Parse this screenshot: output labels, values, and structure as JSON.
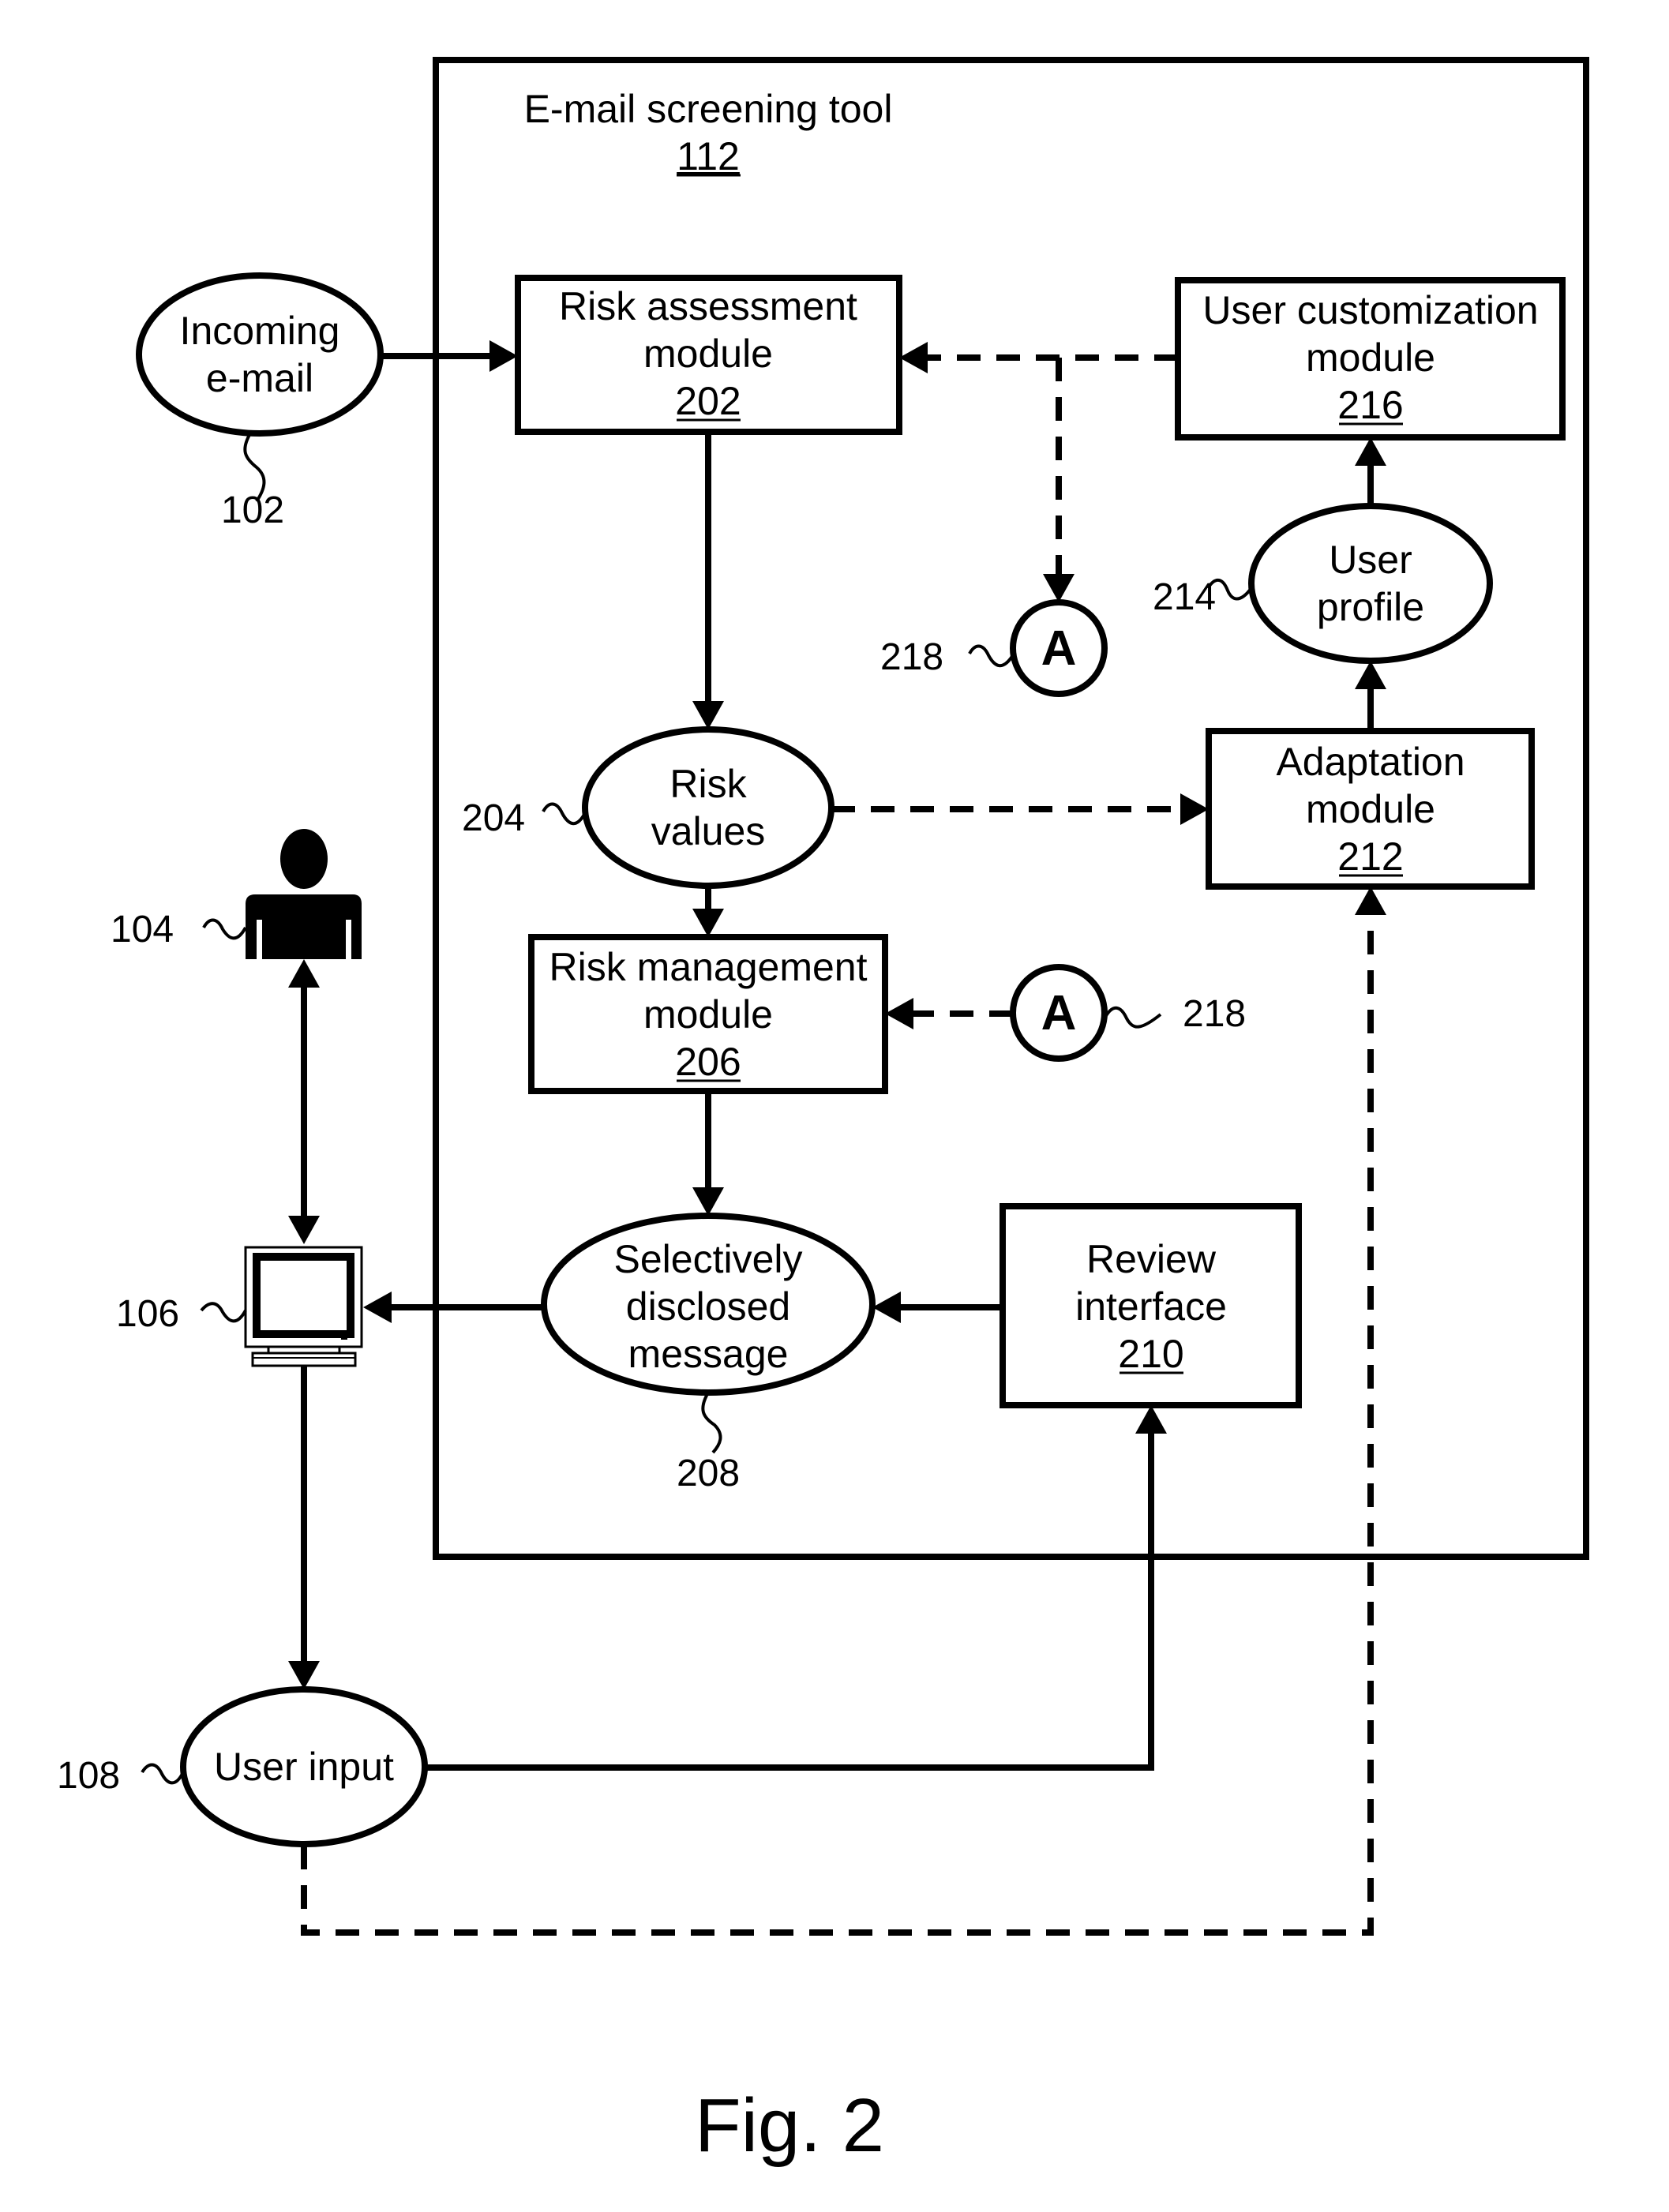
{
  "figure": {
    "caption": "Fig. 2",
    "container": {
      "title": "E-mail screening tool",
      "ref": "112"
    },
    "nodes": {
      "incoming_email": {
        "lines": [
          "Incoming",
          "e-mail"
        ],
        "ref": "102",
        "shape": "ellipse"
      },
      "risk_assessment": {
        "lines": [
          "Risk assessment",
          "module"
        ],
        "ref": "202",
        "shape": "box"
      },
      "risk_values": {
        "lines": [
          "Risk",
          "values"
        ],
        "ref": "204",
        "shape": "ellipse"
      },
      "risk_management": {
        "lines": [
          "Risk management",
          "module"
        ],
        "ref": "206",
        "shape": "box"
      },
      "selectively_disclosed": {
        "lines": [
          "Selectively",
          "disclosed",
          "message"
        ],
        "ref": "208",
        "shape": "ellipse"
      },
      "review_interface": {
        "lines": [
          "Review",
          "interface"
        ],
        "ref": "210",
        "shape": "box"
      },
      "adaptation": {
        "lines": [
          "Adaptation",
          "module"
        ],
        "ref": "212",
        "shape": "box"
      },
      "user_profile": {
        "lines": [
          "User",
          "profile"
        ],
        "ref": "214",
        "shape": "ellipse"
      },
      "user_customization": {
        "lines": [
          "User customization",
          "module"
        ],
        "ref": "216",
        "shape": "box"
      },
      "connector_a_out": {
        "letter": "A",
        "ref": "218"
      },
      "connector_a_in": {
        "letter": "A",
        "ref": "218"
      },
      "user": {
        "ref": "104",
        "icon": "person-icon"
      },
      "computer": {
        "ref": "106",
        "icon": "computer-icon"
      },
      "user_input": {
        "lines": [
          "User input"
        ],
        "ref": "108",
        "shape": "ellipse"
      }
    },
    "edges": [
      {
        "from": "incoming_email",
        "to": "risk_assessment",
        "style": "solid"
      },
      {
        "from": "risk_assessment",
        "to": "risk_values",
        "style": "solid"
      },
      {
        "from": "risk_values",
        "to": "risk_management",
        "style": "solid"
      },
      {
        "from": "risk_values",
        "to": "adaptation",
        "style": "dashed"
      },
      {
        "from": "risk_management",
        "to": "selectively_disclosed",
        "style": "solid"
      },
      {
        "from": "review_interface",
        "to": "selectively_disclosed",
        "style": "solid"
      },
      {
        "from": "selectively_disclosed",
        "to": "computer",
        "style": "solid"
      },
      {
        "from": "adaptation",
        "to": "user_profile",
        "style": "solid"
      },
      {
        "from": "user_profile",
        "to": "user_customization",
        "style": "solid"
      },
      {
        "from": "user_customization",
        "to": "risk_assessment",
        "style": "dashed"
      },
      {
        "from": "user_customization",
        "to": "connector_a_out",
        "style": "dashed"
      },
      {
        "from": "connector_a_in",
        "to": "risk_management",
        "style": "dashed"
      },
      {
        "from": "user",
        "to": "computer",
        "style": "solid-bidirectional"
      },
      {
        "from": "computer",
        "to": "user_input",
        "style": "solid"
      },
      {
        "from": "user_input",
        "to": "review_interface",
        "style": "solid"
      },
      {
        "from": "user_input",
        "to": "adaptation",
        "style": "dashed"
      }
    ]
  }
}
